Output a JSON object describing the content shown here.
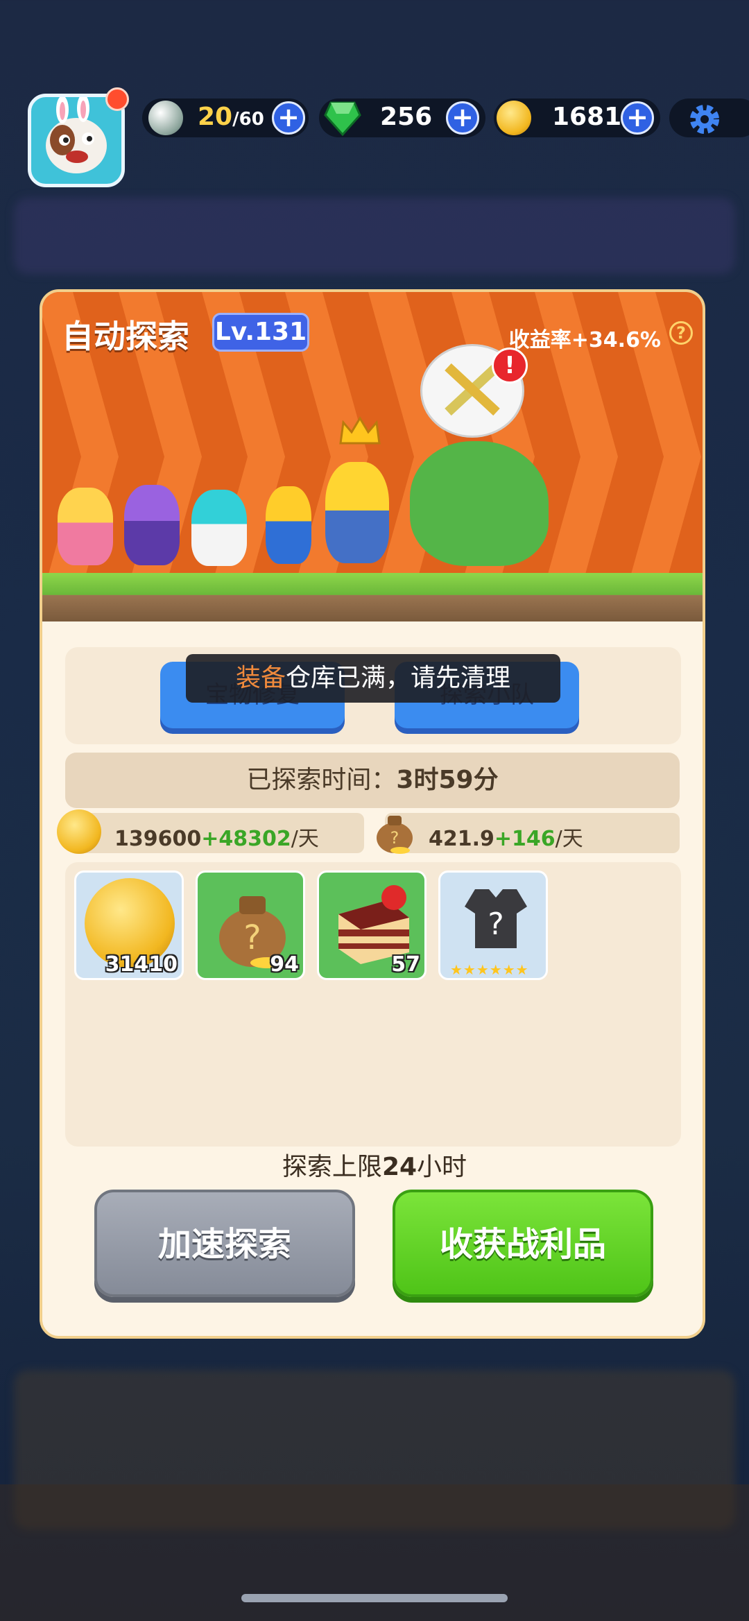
{
  "topbar": {
    "energy_current": "20",
    "energy_max": "/60",
    "gems": "256",
    "coins": "1681",
    "icons": [
      "avatar-dog-icon",
      "energy-orb-icon",
      "gem-icon",
      "coin-icon",
      "plus-icon",
      "gear-icon"
    ]
  },
  "panel": {
    "title": "自动探索",
    "level": "Lv.131",
    "rate_label": "收益率",
    "rate_value": "+34.6%",
    "help_glyph": "?",
    "btn_left": "宝物修复",
    "btn_right": "探索小队",
    "toast_highlight": "装备",
    "toast_rest": "仓库已满，请先清理",
    "explore_time_label": "已探索时间：",
    "explore_time_value": "3时59分",
    "coin_rate_base": "139600",
    "coin_rate_bonus": "+48302",
    "per_day": "/天",
    "bag_rate_base": "421.9",
    "bag_rate_bonus": "+146",
    "items": [
      {
        "name": "coin",
        "count": "31410"
      },
      {
        "name": "mystery-bag",
        "count": "94"
      },
      {
        "name": "cake",
        "count": "57"
      },
      {
        "name": "mystery-armor",
        "count": ""
      }
    ],
    "limit_prefix": "探索上限",
    "limit_value": "24",
    "limit_suffix": "小时",
    "speed_button": "加速探索",
    "collect_button": "收获战利品"
  },
  "colors": {
    "banner": "#e0621c",
    "level_badge": "#3f63e6",
    "collect_green": "#5fcf22",
    "speed_gray": "#8a8f9c",
    "toast_highlight": "#f08a3c"
  }
}
